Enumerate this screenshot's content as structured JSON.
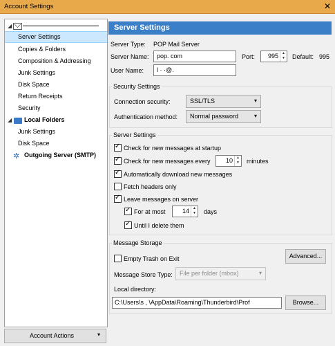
{
  "window": {
    "title": "Account Settings",
    "close": "✕"
  },
  "sidebar": {
    "account_name": "",
    "items": [
      {
        "label": "Server Settings"
      },
      {
        "label": "Copies & Folders"
      },
      {
        "label": "Composition & Addressing"
      },
      {
        "label": "Junk Settings"
      },
      {
        "label": "Disk Space"
      },
      {
        "label": "Return Receipts"
      },
      {
        "label": "Security"
      }
    ],
    "local_folders": {
      "label": "Local Folders",
      "items": [
        {
          "label": "Junk Settings"
        },
        {
          "label": "Disk Space"
        }
      ]
    },
    "outgoing": {
      "label": "Outgoing Server (SMTP)"
    }
  },
  "account_actions": {
    "label": "Account Actions",
    "arrow": "▾"
  },
  "panel": {
    "title": "Server Settings",
    "server_type_label": "Server Type:",
    "server_type_value": "POP Mail Server",
    "server_name_label": "Server Name:",
    "server_name_value": "pop.        com",
    "port_label": "Port:",
    "port_value": "995",
    "default_label": "Default:",
    "default_value": "995",
    "user_name_label": "User Name:",
    "user_name_value": "l        ·   ·@."
  },
  "security": {
    "title": "Security Settings",
    "connection_label": "Connection security:",
    "connection_value": "SSL/TLS",
    "auth_label": "Authentication method:",
    "auth_value": "Normal password"
  },
  "server_settings": {
    "title": "Server Settings",
    "check_startup": {
      "label": "Check for new messages at startup",
      "checked": true
    },
    "check_every": {
      "label": "Check for new messages every",
      "value": "10",
      "unit": "minutes",
      "checked": true
    },
    "auto_download": {
      "label": "Automatically download new messages",
      "checked": true
    },
    "fetch_headers": {
      "label": "Fetch headers only",
      "checked": false
    },
    "leave_on_server": {
      "label": "Leave messages on server",
      "checked": true
    },
    "for_at_most": {
      "label": "For at most",
      "value": "14",
      "unit": "days",
      "checked": true
    },
    "until_delete": {
      "label": "Until I delete them",
      "checked": true
    }
  },
  "storage": {
    "title": "Message Storage",
    "empty_trash": {
      "label": "Empty Trash on Exit",
      "checked": false
    },
    "advanced_button": "Advanced...",
    "store_type_label": "Message Store Type:",
    "store_type_value": "File per folder (mbox)",
    "local_dir_label": "Local directory:",
    "local_dir_value": "C:\\Users\\s   ,          \\AppData\\Roaming\\Thunderbird\\Prof",
    "browse_button": "Browse..."
  }
}
